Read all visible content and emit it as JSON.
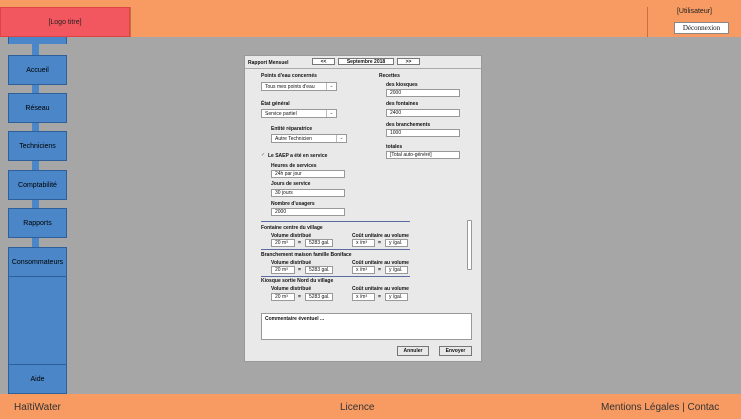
{
  "header": {
    "logo": "[Logo titre]",
    "user": "[Utilisateur]",
    "logout": "Déconnexion"
  },
  "nav": [
    "Accueil",
    "Réseau",
    "Techniciens",
    "Comptabilité",
    "Rapports",
    "Consommateurs",
    "Aide"
  ],
  "footer": {
    "brand": "HaïtiWater",
    "licence": "Licence",
    "legal": "Mentions Légales | Contac"
  },
  "report": {
    "title": "Rapport Mensuel",
    "prev": "<<",
    "month": "Septembre 2018",
    "next": ">>",
    "points_label": "Points d'eau concernés",
    "points_value": "Tous mes points d'eau",
    "etat_label": "État général",
    "etat_value": "Service partiel",
    "entite_label": "Entité réparatrice",
    "entite_value": "Autre Technicien",
    "saep_label": "Le SAEP a été en service",
    "saep_check": "✓",
    "heures_label": "Heures de services",
    "heures_value": "24h par jour",
    "jours_label": "Jours de service",
    "jours_value": "30 jours",
    "usagers_label": "Nombre d'usagers",
    "usagers_value": "2000",
    "recettes_label": "Recettes",
    "kiosques_label": "des kiosques",
    "kiosques_value": "2000",
    "fontaines_label": "des fontaines",
    "fontaines_value": "2400",
    "branchements_label": "des branchements",
    "branchements_value": "1000",
    "totales_label": "totales",
    "totales_value": "[Total auto-généré]",
    "points": [
      {
        "name": "Fontaine centre du village",
        "vol_label": "Volume distribué",
        "cout_label": "Coût unitaire au volume",
        "vol_m3": "20 m³",
        "eq": "=",
        "vol_gal": "5283 gal.",
        "cout_m3": "x /m³",
        "cout_gal": "y /gal."
      },
      {
        "name": "Branchement maison famille Boniface",
        "vol_label": "Volume distribué",
        "cout_label": "Coût unitaire au volume",
        "vol_m3": "20 m³",
        "eq": "=",
        "vol_gal": "5283 gal.",
        "cout_m3": "x /m³",
        "cout_gal": "y /gal."
      },
      {
        "name": "Kiosque sortie Nord du village",
        "vol_label": "Volume distribué",
        "cout_label": "Coût unitaire au volume",
        "vol_m3": "20 m³",
        "eq": "=",
        "vol_gal": "5283 gal.",
        "cout_m3": "x /m³",
        "cout_gal": "y /gal."
      }
    ],
    "comment_placeholder": "Commentaire éventuel ...",
    "cancel": "Annuler",
    "submit": "Envoyer"
  }
}
